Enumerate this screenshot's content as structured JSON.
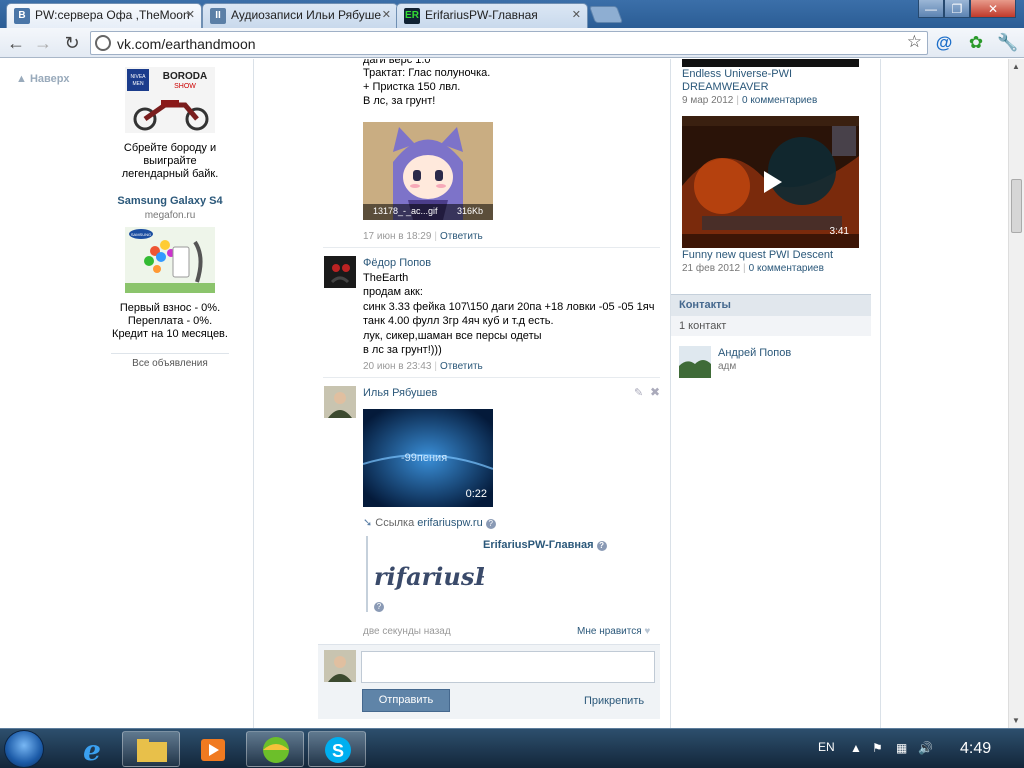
{
  "browser": {
    "tabs": [
      {
        "title": "PW:сервера Офа ,TheMoon",
        "favicon": "vk-icon",
        "favicon_text": "B",
        "color": "#4a76a8"
      },
      {
        "title": "Аудиозаписи Ильи Рябуше",
        "favicon": "pause-icon",
        "favicon_text": "II",
        "color": "#5b7fa6"
      },
      {
        "title": "ErifariusPW-Главная",
        "favicon": "er-icon",
        "favicon_text": "ER",
        "color": "#123"
      }
    ],
    "url": "vk.com/earthandmoon"
  },
  "left": {
    "back_label": "▲ Наверх",
    "ads": [
      {
        "text": "Сбрейте бороду и выиграйте легендарный байк."
      },
      {
        "title": "Samsung Galaxy S4",
        "domain": "megafon.ru",
        "text": "Первый взнос - 0%. Переплата - 0%. Кредит на 10 месяцев."
      }
    ],
    "all_ads": "Все объявления"
  },
  "wall": {
    "post1_text": [
      "даги верс 1.0",
      "Трактат: Глас полуночка.",
      "+ Пристка 150 лвл.",
      "В лс, за грунт!"
    ],
    "post1_image_caption": "13178_-_ac...gif",
    "post1_image_size": "316Kb",
    "post1_date": "17 июн в 18:29",
    "reply": "Ответить",
    "post2_author": "Фёдор Попов",
    "post2_text": [
      "TheEarth",
      "продам акк:",
      "синк 3.33 фейка 107\\150 даги 20па +18 ловки -05 -05 1яч",
      "танк 4.00 фулл 3гр 4яч куб и т.д есть.",
      "лук, сикер,шаман все персы одеты",
      "в лс за грунт!)))"
    ],
    "post2_date": "20 июн в 23:43",
    "post3_author": "Илья Рябушев",
    "video_overlay": "-99пения",
    "video_duration": "0:22",
    "link_label": "Ссылка",
    "link_domain": "erifariuspw.ru",
    "link_title": "ErifariusPW-Главная",
    "link_logo_text": "rifariusP",
    "post3_date": "две секунды назад",
    "like": "Мне нравится",
    "send": "Отправить",
    "attach": "Прикрепить"
  },
  "right": {
    "video1_title": "Endless Universe-PWI DREAMWEAVER",
    "video1_date": "9 мар 2012",
    "video1_comments": "0 комментариев",
    "video2_duration": "3:41",
    "video2_title": "Funny new quest PWI Descent",
    "video2_date": "21 фев 2012",
    "video2_comments": "0 комментариев",
    "contacts_head": "Контакты",
    "contacts_count": "1 контакт",
    "contact_name": "Андрей Попов",
    "contact_role": "адм"
  },
  "taskbar": {
    "lang": "EN",
    "time": "4:49"
  }
}
